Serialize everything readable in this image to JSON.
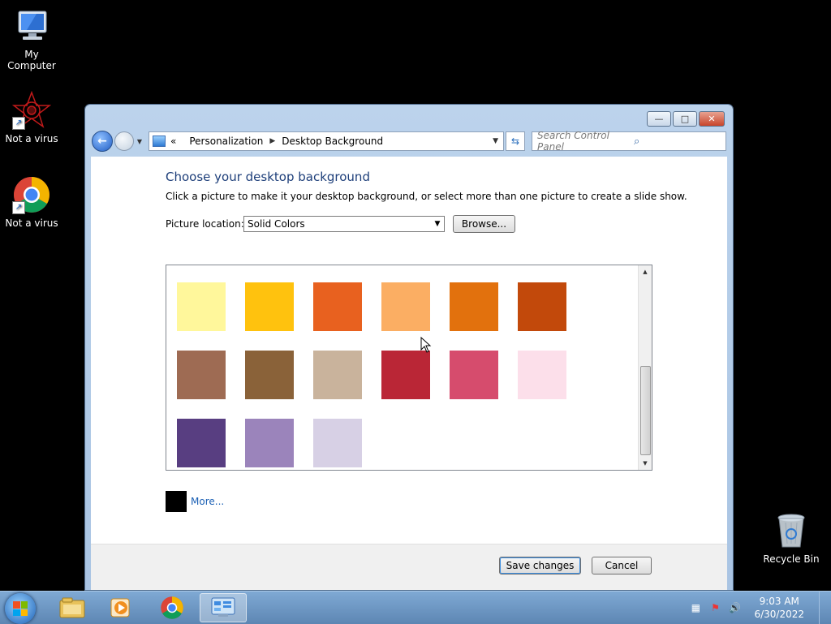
{
  "desktop": {
    "icons": [
      {
        "label": "My Computer"
      },
      {
        "label": "Not a virus"
      },
      {
        "label": "Not a virus"
      },
      {
        "label": "Recycle Bin"
      }
    ]
  },
  "window": {
    "caption_buttons": [
      "minimize",
      "maximize",
      "close"
    ],
    "breadcrumb": {
      "overflow": "«",
      "items": [
        "Personalization",
        "Desktop Background"
      ]
    },
    "search_placeholder": "Search Control Panel",
    "heading": "Choose your desktop background",
    "description": "Click a picture to make it your desktop background, or select more than one picture to create a slide show.",
    "picture_location_label": "Picture location:",
    "picture_location_value": "Solid Colors",
    "browse_label": "Browse...",
    "swatch_colors": [
      "#fff79b",
      "#ffc20e",
      "#e8611f",
      "#fbae63",
      "#e2710d",
      "#c2490b",
      "#9e6b53",
      "#8a6239",
      "#c9b39c",
      "#ba2636",
      "#d64c6d",
      "#fcdfea",
      "#583e81",
      "#9b84bb",
      "#d7d0e5"
    ],
    "more_swatch_color": "#000000",
    "more_label": "More...",
    "save_label": "Save changes",
    "cancel_label": "Cancel"
  },
  "taskbar": {
    "pinned": [
      "start-button",
      "explorer",
      "media-player",
      "chrome",
      "control-panel"
    ],
    "clock_time": "9:03 AM",
    "clock_date": "6/30/2022"
  }
}
